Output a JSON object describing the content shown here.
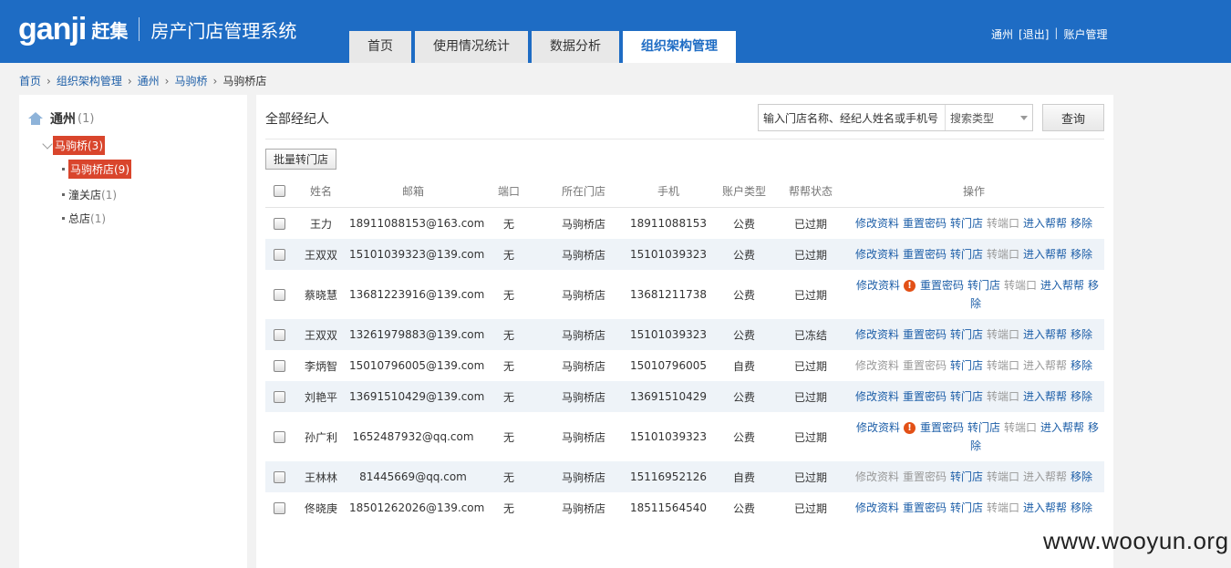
{
  "header": {
    "logo_text": "ganji",
    "logo_cn": "赶集",
    "system_title": "房产门店管理系统",
    "tabs": [
      {
        "label": "首页",
        "active": false
      },
      {
        "label": "使用情况统计",
        "active": false
      },
      {
        "label": "数据分析",
        "active": false
      },
      {
        "label": "组织架构管理",
        "active": true
      }
    ],
    "user": "通州",
    "logout": "[退出]",
    "separator": "|",
    "account": "账户管理"
  },
  "breadcrumb": [
    "首页",
    "组织架构管理",
    "通州",
    "马驹桥",
    "马驹桥店"
  ],
  "tree": {
    "root": {
      "label": "通州",
      "count": "(1)"
    },
    "level1": {
      "label": "马驹桥(3)"
    },
    "level2_selected": {
      "label": "马驹桥店(9)"
    },
    "leaves": [
      {
        "label": "潼关店",
        "count": "(1)"
      },
      {
        "label": "总店",
        "count": "(1)"
      }
    ]
  },
  "main": {
    "title": "全部经纪人",
    "search_placeholder": "输入门店名称、经纪人姓名或手机号",
    "search_type": "搜索类型",
    "query_button": "查询",
    "batch_button": "批量转门店"
  },
  "table": {
    "headers": [
      "姓名",
      "邮箱",
      "端口",
      "所在门店",
      "手机",
      "账户类型",
      "帮帮状态",
      "操作"
    ],
    "op_labels": {
      "edit": "修改资料",
      "reset": "重置密码",
      "transfer_store": "转门店",
      "transfer_port": "转端口",
      "enter": "进入帮帮",
      "remove": "移除"
    },
    "rows": [
      {
        "name": "王力",
        "email": "18911088153@163.com",
        "port": "无",
        "store": "马驹桥店",
        "phone": "18911088153",
        "type": "公费",
        "status": "已过期",
        "warn": false,
        "edit_enabled": true,
        "reset_enabled": true,
        "enter_enabled": true
      },
      {
        "name": "王双双",
        "email": "15101039323@139.com",
        "port": "无",
        "store": "马驹桥店",
        "phone": "15101039323",
        "type": "公费",
        "status": "已过期",
        "warn": false,
        "edit_enabled": true,
        "reset_enabled": true,
        "enter_enabled": true
      },
      {
        "name": "蔡晓慧",
        "email": "13681223916@139.com",
        "port": "无",
        "store": "马驹桥店",
        "phone": "13681211738",
        "type": "公费",
        "status": "已过期",
        "warn": true,
        "edit_enabled": true,
        "reset_enabled": true,
        "enter_enabled": true
      },
      {
        "name": "王双双",
        "email": "13261979883@139.com",
        "port": "无",
        "store": "马驹桥店",
        "phone": "15101039323",
        "type": "公费",
        "status": "已冻结",
        "warn": false,
        "edit_enabled": true,
        "reset_enabled": true,
        "enter_enabled": true
      },
      {
        "name": "李炳智",
        "email": "15010796005@139.com",
        "port": "无",
        "store": "马驹桥店",
        "phone": "15010796005",
        "type": "自费",
        "status": "已过期",
        "warn": false,
        "edit_enabled": false,
        "reset_enabled": false,
        "enter_enabled": false
      },
      {
        "name": "刘艳平",
        "email": "13691510429@139.com",
        "port": "无",
        "store": "马驹桥店",
        "phone": "13691510429",
        "type": "公费",
        "status": "已过期",
        "warn": false,
        "edit_enabled": true,
        "reset_enabled": true,
        "enter_enabled": true
      },
      {
        "name": "孙广利",
        "email": "1652487932@qq.com",
        "port": "无",
        "store": "马驹桥店",
        "phone": "15101039323",
        "type": "公费",
        "status": "已过期",
        "warn": true,
        "edit_enabled": true,
        "reset_enabled": true,
        "enter_enabled": true
      },
      {
        "name": "王林林",
        "email": "81445669@qq.com",
        "port": "无",
        "store": "马驹桥店",
        "phone": "15116952126",
        "type": "自费",
        "status": "已过期",
        "warn": false,
        "edit_enabled": false,
        "reset_enabled": false,
        "enter_enabled": false
      },
      {
        "name": "佟晓庚",
        "email": "18501262026@139.com",
        "port": "无",
        "store": "马驹桥店",
        "phone": "18511564540",
        "type": "公费",
        "status": "已过期",
        "warn": false,
        "edit_enabled": true,
        "reset_enabled": true,
        "enter_enabled": true
      }
    ]
  },
  "watermark": "www.wooyun.org"
}
